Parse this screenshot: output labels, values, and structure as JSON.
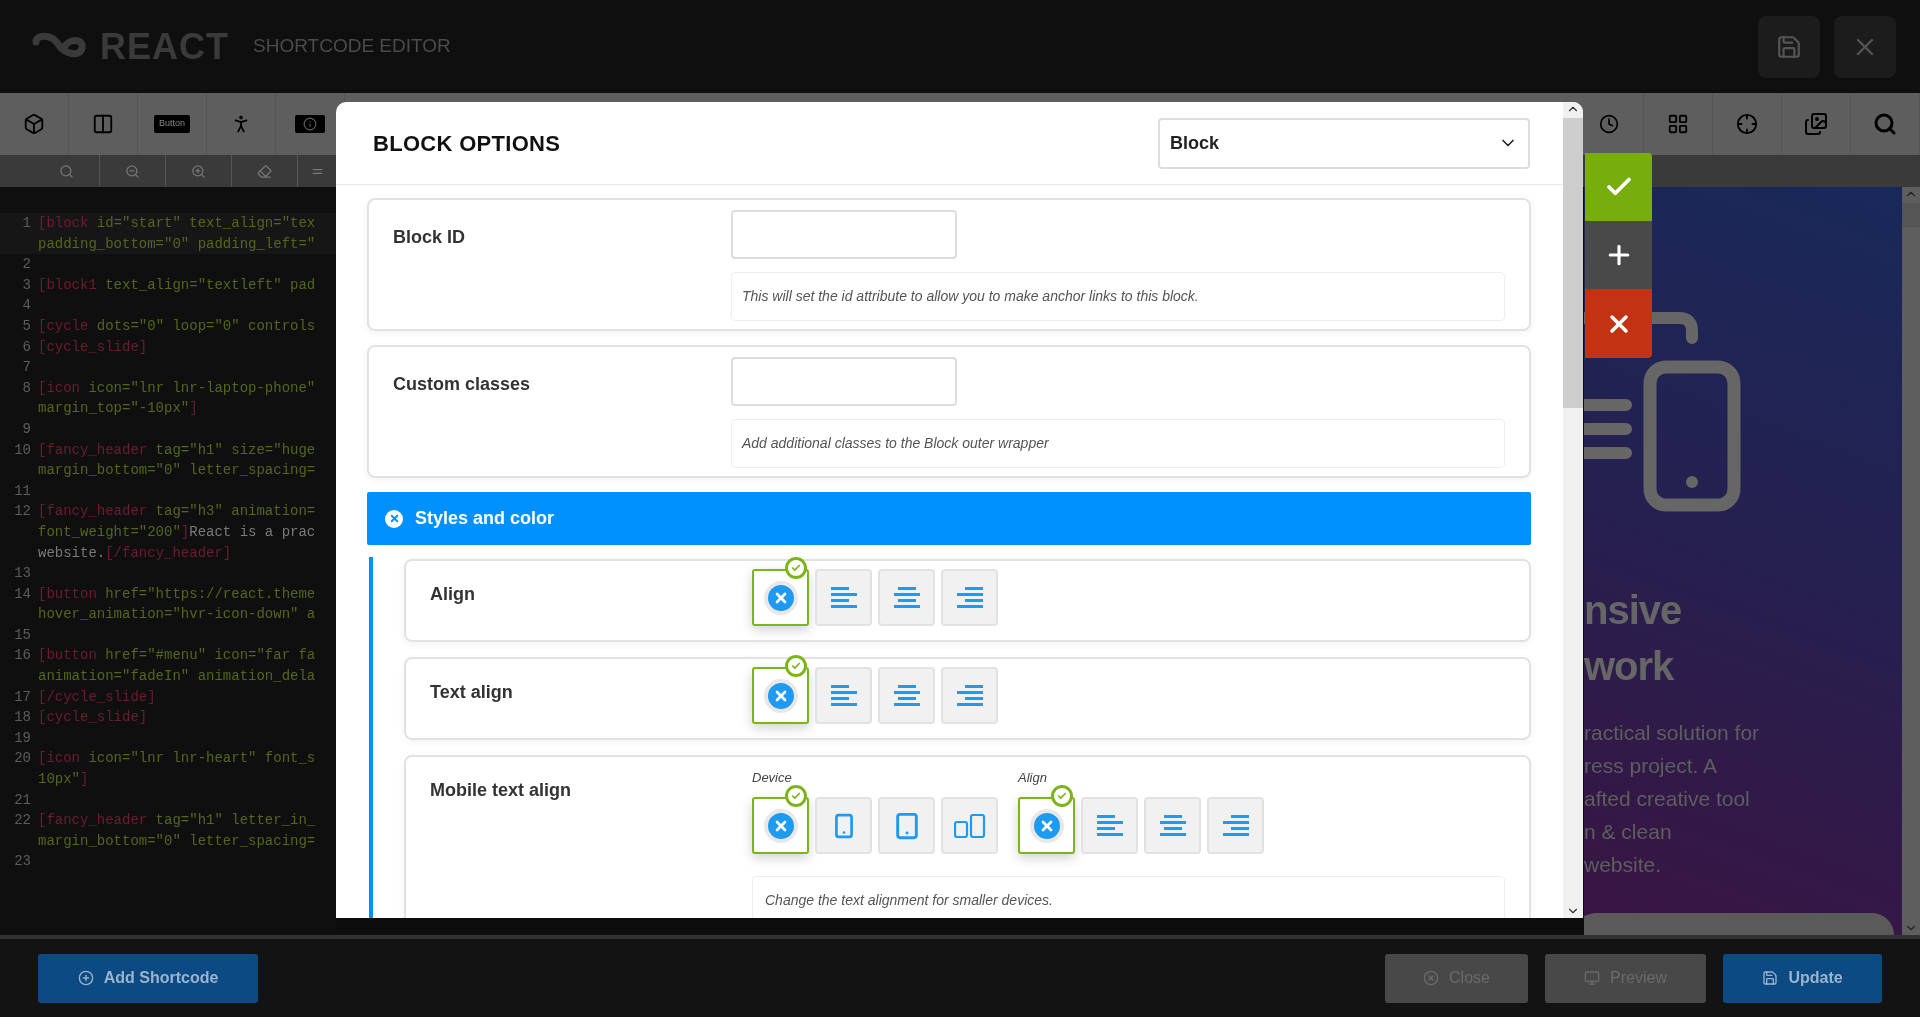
{
  "header": {
    "logo_text": "REACT",
    "title": "SHORTCODE EDITOR"
  },
  "toolbar": {
    "button_chip": "Button"
  },
  "code_rows": [
    {
      "number": "1",
      "segments": [
        {
          "kind": "tag",
          "text": "[block"
        },
        {
          "kind": "attr",
          "text": " id=\"start\" text_align=\"tex"
        }
      ]
    },
    {
      "segments": [
        {
          "kind": "attr",
          "text": "padding_bottom=\"0\" padding_left=\""
        }
      ]
    },
    {
      "number": "2",
      "segments": []
    },
    {
      "number": "3",
      "segments": [
        {
          "kind": "tag",
          "text": "[block1"
        },
        {
          "kind": "attr",
          "text": " text_align=\"textleft\" pad"
        }
      ]
    },
    {
      "number": "4",
      "segments": []
    },
    {
      "number": "5",
      "segments": [
        {
          "kind": "tag",
          "text": "[cycle"
        },
        {
          "kind": "attr",
          "text": " dots=\"0\" loop=\"0\" controls"
        }
      ]
    },
    {
      "number": "6",
      "segments": [
        {
          "kind": "tag",
          "text": "[cycle_slide]"
        }
      ]
    },
    {
      "number": "7",
      "segments": []
    },
    {
      "number": "8",
      "segments": [
        {
          "kind": "tag",
          "text": "[icon"
        },
        {
          "kind": "attr",
          "text": " icon=\"lnr lnr-laptop-phone\""
        }
      ]
    },
    {
      "segments": [
        {
          "kind": "attr",
          "text": "margin_top=\"-10px\""
        },
        {
          "kind": "tag",
          "text": "]"
        }
      ]
    },
    {
      "number": "9",
      "segments": []
    },
    {
      "number": "10",
      "segments": [
        {
          "kind": "tag",
          "text": "[fancy_header"
        },
        {
          "kind": "attr",
          "text": " tag=\"h1\" size=\"huge"
        }
      ]
    },
    {
      "segments": [
        {
          "kind": "attr",
          "text": "margin_bottom=\"0\" letter_spacing="
        }
      ]
    },
    {
      "number": "11",
      "segments": []
    },
    {
      "number": "12",
      "segments": [
        {
          "kind": "tag",
          "text": "[fancy_header"
        },
        {
          "kind": "attr",
          "text": " tag=\"h3\" animation="
        }
      ]
    },
    {
      "segments": [
        {
          "kind": "attr",
          "text": "font_weight=\"200\""
        },
        {
          "kind": "tag",
          "text": "]"
        },
        {
          "kind": "text",
          "text": "React is a prac"
        }
      ]
    },
    {
      "segments": [
        {
          "kind": "text",
          "text": "website."
        },
        {
          "kind": "tag",
          "text": "[/fancy_header]"
        }
      ]
    },
    {
      "number": "13",
      "segments": []
    },
    {
      "number": "14",
      "segments": [
        {
          "kind": "tag",
          "text": "[button"
        },
        {
          "kind": "attr",
          "text": " href=\"https://react.theme"
        }
      ]
    },
    {
      "segments": [
        {
          "kind": "attr",
          "text": "hover_animation=\"hvr-icon-down\" a"
        }
      ]
    },
    {
      "number": "15",
      "segments": []
    },
    {
      "number": "16",
      "segments": [
        {
          "kind": "tag",
          "text": "[button"
        },
        {
          "kind": "attr",
          "text": " href=\"#menu\" icon=\"far fa"
        }
      ]
    },
    {
      "segments": [
        {
          "kind": "attr",
          "text": "animation=\"fadeIn\" animation_dela"
        }
      ]
    },
    {
      "number": "17",
      "segments": [
        {
          "kind": "tag",
          "text": "[/cycle_slide]"
        }
      ]
    },
    {
      "number": "18",
      "segments": [
        {
          "kind": "tag",
          "text": "[cycle_slide]"
        }
      ]
    },
    {
      "number": "19",
      "segments": []
    },
    {
      "number": "20",
      "segments": [
        {
          "kind": "tag",
          "text": "[icon"
        },
        {
          "kind": "attr",
          "text": " icon=\"lnr lnr-heart\" font_s"
        }
      ]
    },
    {
      "segments": [
        {
          "kind": "attr",
          "text": "10px\""
        },
        {
          "kind": "tag",
          "text": "]"
        }
      ]
    },
    {
      "number": "21",
      "segments": []
    },
    {
      "number": "22",
      "segments": [
        {
          "kind": "tag",
          "text": "[fancy_header"
        },
        {
          "kind": "attr",
          "text": " tag=\"h1\" letter_in_"
        }
      ]
    },
    {
      "segments": [
        {
          "kind": "attr",
          "text": "margin_bottom=\"0\" letter_spacing="
        }
      ]
    },
    {
      "number": "23",
      "segments": []
    }
  ],
  "preview": {
    "heading_lines": [
      "nsive",
      "work"
    ],
    "body_lines": [
      "ractical solution for",
      "ress project. A",
      "afted creative tool",
      "n & clean",
      "website."
    ]
  },
  "modal": {
    "title": "BLOCK OPTIONS",
    "type_select": "Block",
    "fields": [
      {
        "label": "Block ID",
        "help": "This will set the id attribute to allow you to make anchor links to this block."
      },
      {
        "label": "Custom classes",
        "help": "Add additional classes to the Block outer wrapper"
      }
    ],
    "section": {
      "title": "Styles and color"
    },
    "align_rows": [
      {
        "label": "Align",
        "groups": [
          {
            "options": [
              {
                "kind": "none",
                "selected": true
              },
              {
                "kind": "left",
                "selected": false
              },
              {
                "kind": "center",
                "selected": false
              },
              {
                "kind": "right",
                "selected": false
              }
            ]
          }
        ]
      },
      {
        "label": "Text align",
        "groups": [
          {
            "options": [
              {
                "kind": "none",
                "selected": true
              },
              {
                "kind": "left",
                "selected": false
              },
              {
                "kind": "center",
                "selected": false
              },
              {
                "kind": "right",
                "selected": false
              }
            ]
          }
        ]
      },
      {
        "label": "Mobile text align",
        "groups": [
          {
            "caption": "Device",
            "options": [
              {
                "kind": "none",
                "selected": true
              },
              {
                "kind": "phone",
                "selected": false
              },
              {
                "kind": "tablet",
                "selected": false
              },
              {
                "kind": "devices",
                "selected": false
              }
            ]
          },
          {
            "caption": "Align",
            "options": [
              {
                "kind": "none",
                "selected": true
              },
              {
                "kind": "left",
                "selected": false
              },
              {
                "kind": "center",
                "selected": false
              },
              {
                "kind": "right",
                "selected": false
              }
            ]
          }
        ],
        "help": "Change the text alignment for smaller devices."
      }
    ]
  },
  "bottom_buttons": [
    {
      "kind": "add",
      "label": "Add Shortcode",
      "disabled": false
    },
    {
      "kind": "close",
      "label": "Close",
      "disabled": true
    },
    {
      "kind": "preview",
      "label": "Preview",
      "disabled": true
    },
    {
      "kind": "update",
      "label": "Update",
      "disabled": false
    }
  ]
}
